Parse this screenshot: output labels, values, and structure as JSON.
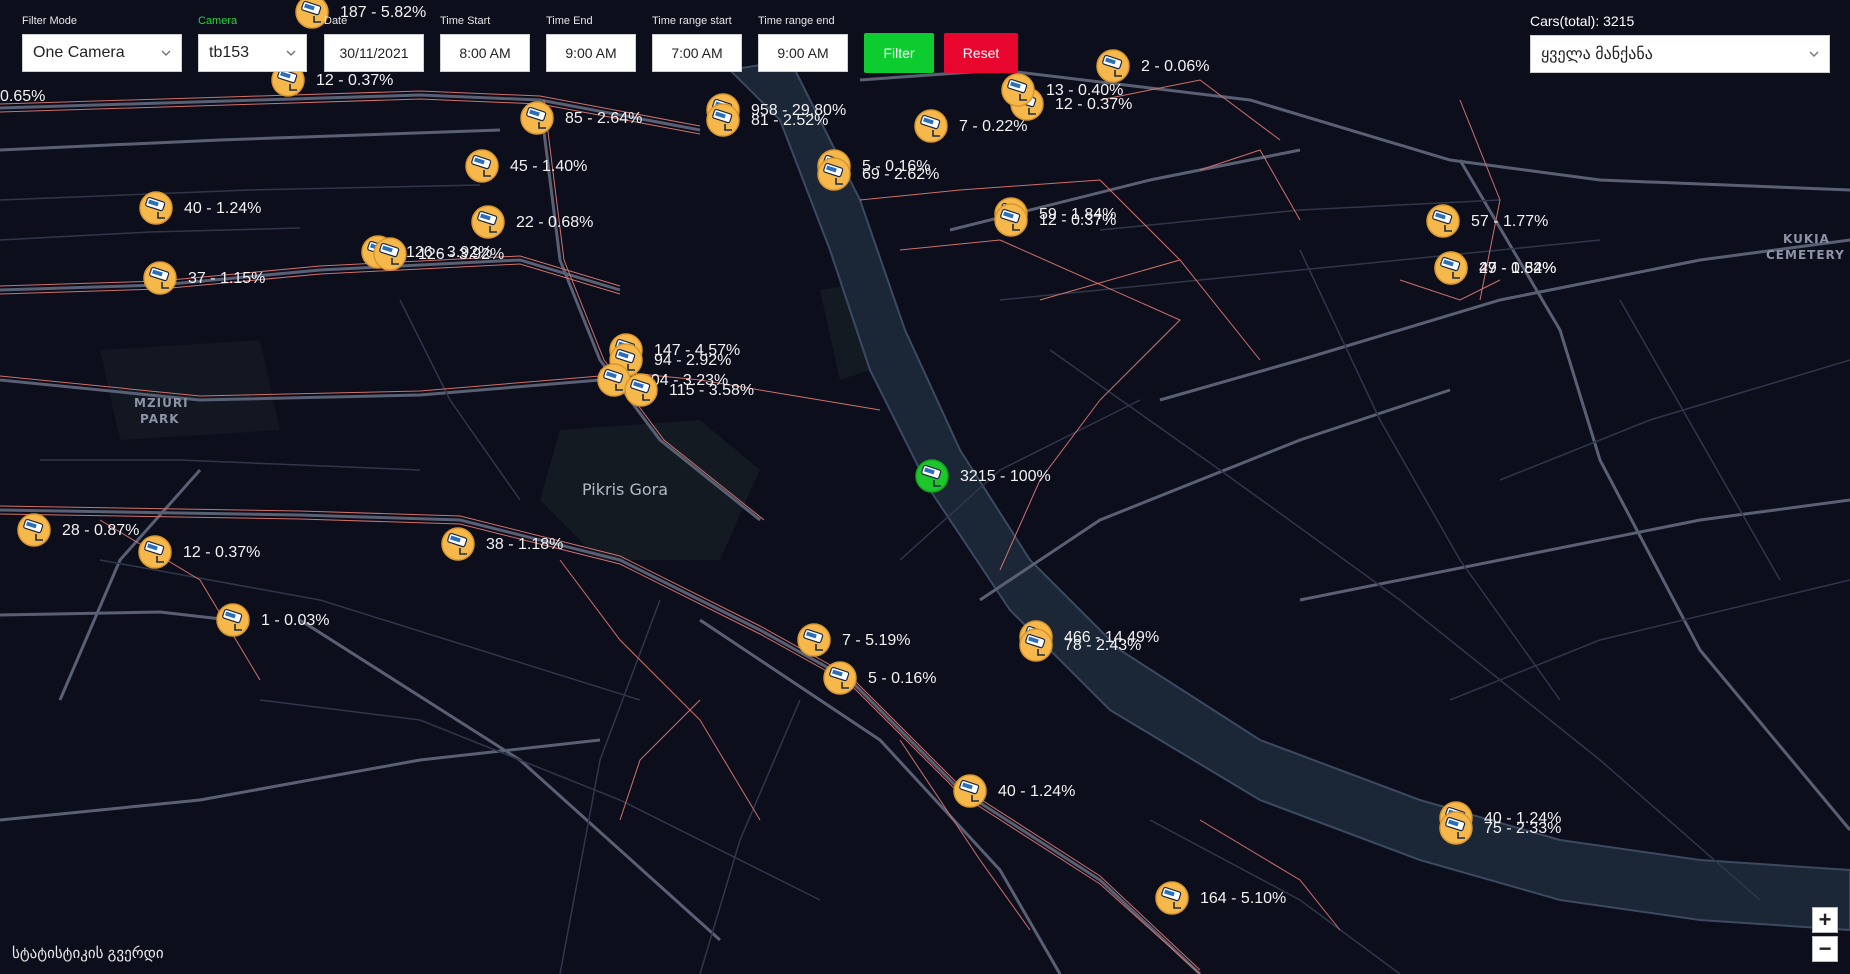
{
  "filters": {
    "filter_mode_label": "Filter Mode",
    "filter_mode_value": "One Camera",
    "camera_label": "Camera",
    "camera_value": "tb153",
    "date_label": "Date",
    "date_value": "30/11/2021",
    "time_start_label": "Time Start",
    "time_start_value": "8:00 AM",
    "time_end_label": "Time End",
    "time_end_value": "9:00 AM",
    "range_start_label": "Time range start",
    "range_start_value": "7:00 AM",
    "range_end_label": "Time range end",
    "range_end_value": "9:00 AM",
    "filter_button": "Filter",
    "reset_button": "Reset"
  },
  "cars": {
    "label": "Cars(total): 3215",
    "select_value": "ყველა მანქანა"
  },
  "map": {
    "place_labels": [
      "Pikris Gora",
      "MZIURI",
      "PARK",
      "KUKIA",
      "CEMETERY"
    ],
    "zoom_in": "+",
    "zoom_out": "−"
  },
  "footer": {
    "text": "სტატისტიკის გვერდი"
  },
  "colors": {
    "filter_green": "#0ccc2f",
    "reset_red": "#e8062e",
    "marker_orange": "#f7b84b",
    "selected_green": "#1ec62c"
  },
  "markers": [
    {
      "text": "3215 - 100%",
      "selected": true
    },
    {
      "text": "958 - 29.80%"
    },
    {
      "text": "81 - 2.52%"
    },
    {
      "text": "7 - 0.22%"
    },
    {
      "text": "12 - 0.37%"
    },
    {
      "text": "13 - 0.40%"
    },
    {
      "text": "2 - 0.06%"
    },
    {
      "text": "187 - 5.82%"
    },
    {
      "text": "5 - 0.16%"
    },
    {
      "text": "69 - 2.62%"
    },
    {
      "text": "59 - 1.84%"
    },
    {
      "text": "12 - 0.37%"
    },
    {
      "text": "57 - 1.77%"
    },
    {
      "text": "27 - 0.84%"
    },
    {
      "text": "49 - 1.52%"
    },
    {
      "text": "40 - 1.24%"
    },
    {
      "text": "37 - 1.15%"
    },
    {
      "text": "22 - 0.68%"
    },
    {
      "text": "45 - 1.40%"
    },
    {
      "text": "85 - 2.64%"
    },
    {
      "text": "126 - 3.92%"
    },
    {
      "text": "126 - 3.92%"
    },
    {
      "text": "147 - 4.57%"
    },
    {
      "text": "94 - 2.92%"
    },
    {
      "text": "104 - 3.23%"
    },
    {
      "text": "115 - 3.58%"
    },
    {
      "text": "28 - 0.87%"
    },
    {
      "text": "12 - 0.37%"
    },
    {
      "text": "38 - 1.18%"
    },
    {
      "text": "1 - 0.03%"
    },
    {
      "text": "7 - 5.19%"
    },
    {
      "text": "5 - 0.16%"
    },
    {
      "text": "466 - 14.49%"
    },
    {
      "text": "78 - 2.43%"
    },
    {
      "text": "40 - 1.24%"
    },
    {
      "text": "40 - 1.24%"
    },
    {
      "text": "75 - 2.33%"
    },
    {
      "text": "164 - 5.10%"
    },
    {
      "text": "12 - 0.37%"
    },
    {
      "text": "0.65%"
    }
  ]
}
